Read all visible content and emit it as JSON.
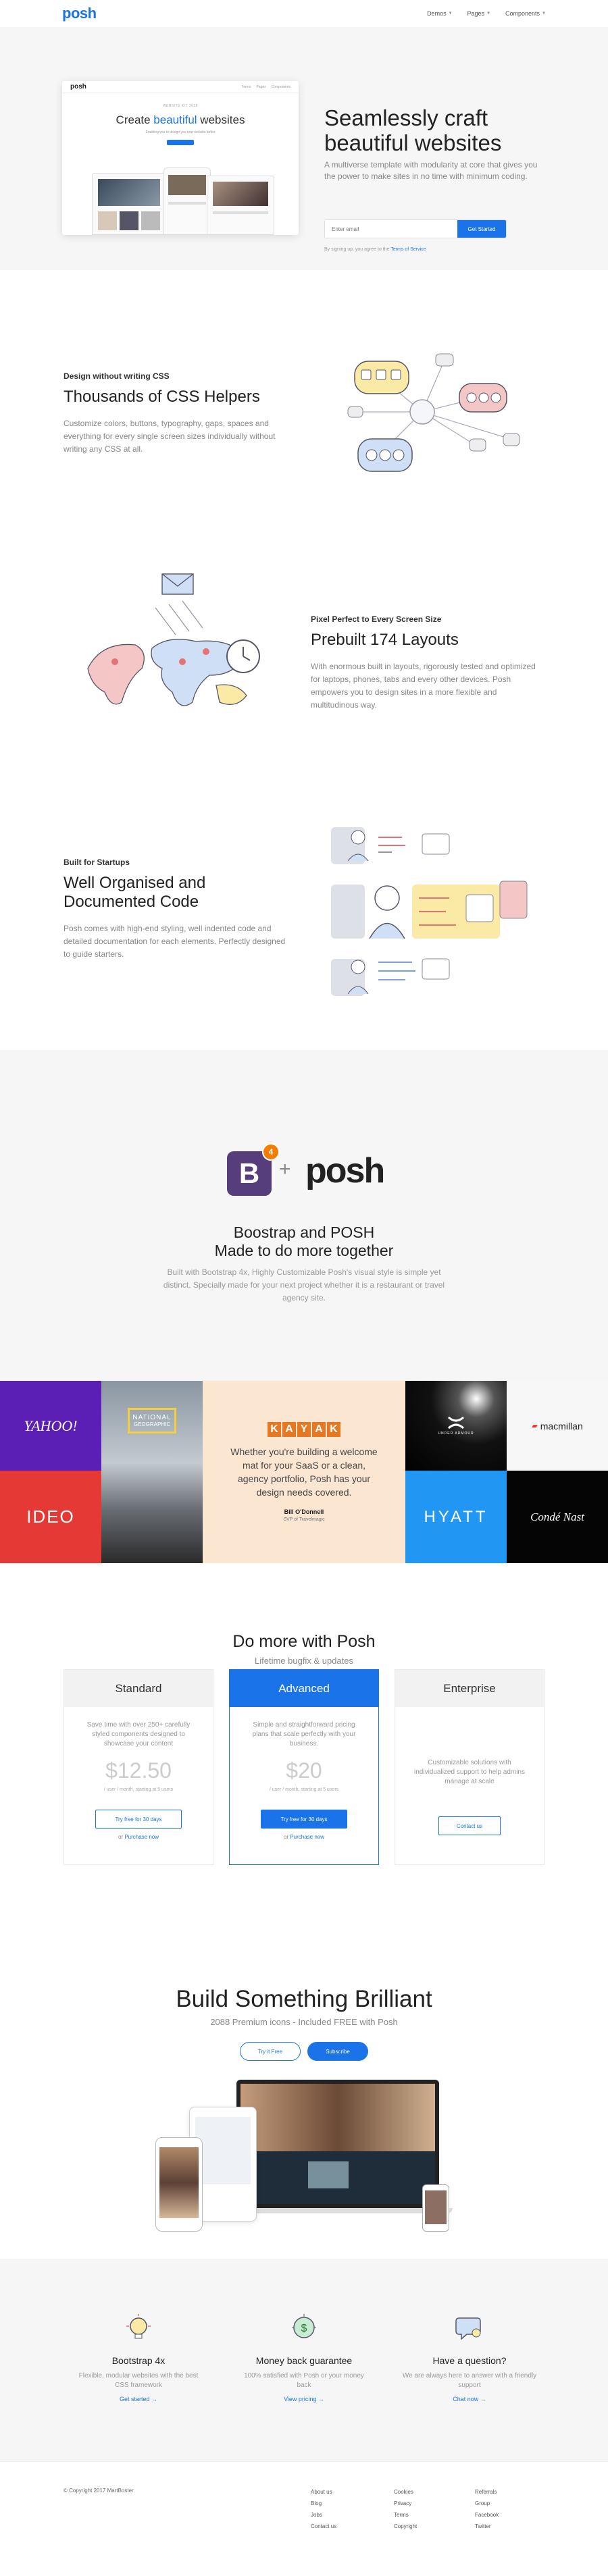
{
  "nav": {
    "logo": "posh",
    "links": [
      "Demos",
      "Pages",
      "Components"
    ]
  },
  "hero": {
    "mock_logo": "posh",
    "mock_links": [
      "Terms",
      "Pages",
      "Components"
    ],
    "mock_kicker": "WEBSITE KIT 2018",
    "mock_title_a": "Create ",
    "mock_title_b": "beautiful",
    "mock_title_c": " websites",
    "mock_sub": "Enabling you to design you new website better",
    "title": "Seamlessly craft beautiful websites",
    "lead": "A multiverse template with modularity at core that gives you the power to make sites in no time with minimum coding.",
    "email_placeholder": "Enter email",
    "cta": "Get Started",
    "terms_prefix": "By signing up, you agree to the ",
    "terms_link": "Terms of Service"
  },
  "features": [
    {
      "kicker": "Design without writing CSS",
      "title": "Thousands of CSS Helpers",
      "text": "Customize colors, buttons, typography, gaps, spaces and everything for every single screen sizes individually without writing any CSS at all."
    },
    {
      "kicker": "Pixel Perfect to Every Screen Size",
      "title": "Prebuilt 174 Layouts",
      "text": "With enormous built in layouts, rigorously tested and optimized for laptops, phones, tabs and every other devices. Posh empowers you to design sites in a more flexible and multitudinous way."
    },
    {
      "kicker": "Built for Startups",
      "title": "Well Organised and Documented Code",
      "text": "Posh comes with high-end styling, well indented code and detailed documentation for each elements. Perfectly designed to guide starters."
    }
  ],
  "bootstrap": {
    "badge": "4",
    "b_letter": "B",
    "plus": "+",
    "posh": "posh",
    "title_1": "Boostrap and POSH",
    "title_2": "Made to do more together",
    "text": "Built with Bootstrap 4x, Highly Customizable Posh's visual style is simple yet distinct. Specially made for your next project whether it is a restaurant or travel agency site."
  },
  "logos": {
    "yahoo": "YAHOO!",
    "natgeo_1": "NATIONAL",
    "natgeo_2": "GEOGRAPHIC",
    "kayak": [
      "K",
      "A",
      "Y",
      "A",
      "K"
    ],
    "quote": "Whether you're building a welcome mat for your SaaS or a clean, agency portfolio, Posh has your design needs covered.",
    "author": "Bill O'Donnell",
    "role": "SVP of Travelmagic",
    "ua": "UNDER ARMOUR",
    "macmillan": "macmillan",
    "ideo": "IDEO",
    "hyatt": "HYATT",
    "conde": "Condé Nast"
  },
  "pricing": {
    "title": "Do more with Posh",
    "sub": "Lifetime bugfix & updates",
    "plans": [
      {
        "name": "Standard",
        "desc": "Save time with over 250+ carefully styled components designed to showcase your content",
        "price": "$12.50",
        "note": "/ user / month, starting at 5 users",
        "btn": "Try free for 30 days",
        "or": "or",
        "link": "Purchase now"
      },
      {
        "name": "Advanced",
        "desc": "Simple and straightforward pricing plans that scale perfectly with your business.",
        "price": "$20",
        "note": "/ user / month, starting at 5 users",
        "btn": "Try free for 30 days",
        "or": "or",
        "link": "Purchase now"
      },
      {
        "name": "Enterprise",
        "desc": "Customizable solutions with individualized support to help admins manage at scale",
        "btn": "Contact us"
      }
    ]
  },
  "brilliant": {
    "title": "Build Something Brilliant",
    "sub": "2088 Premium icons - Included FREE with Posh",
    "btn1": "Try it Free",
    "btn2": "Subscribe"
  },
  "three": [
    {
      "title": "Bootstrap 4x",
      "text": "Flexible, modular websites with the best CSS framework",
      "link": "Get started →"
    },
    {
      "title": "Money back guarantee",
      "text": "100% satisfied with Posh or your money back",
      "link": "View pricing →"
    },
    {
      "title": "Have a question?",
      "text": "We are always here to answer with a friendly support",
      "link": "Chat now →"
    }
  ],
  "footer": {
    "copy": "© Copyright 2017 MartBoster",
    "col1": [
      "About us",
      "Blog",
      "Jobs",
      "Contact us"
    ],
    "col2": [
      "Cookies",
      "Privacy",
      "Terms",
      "Copyright"
    ],
    "col3": [
      "Referrals",
      "Group",
      "Facebook",
      "Twitter"
    ]
  },
  "colors": {
    "accent": "#1a73e8",
    "bootstrap": "#563d7c",
    "badge": "#f57c00"
  }
}
